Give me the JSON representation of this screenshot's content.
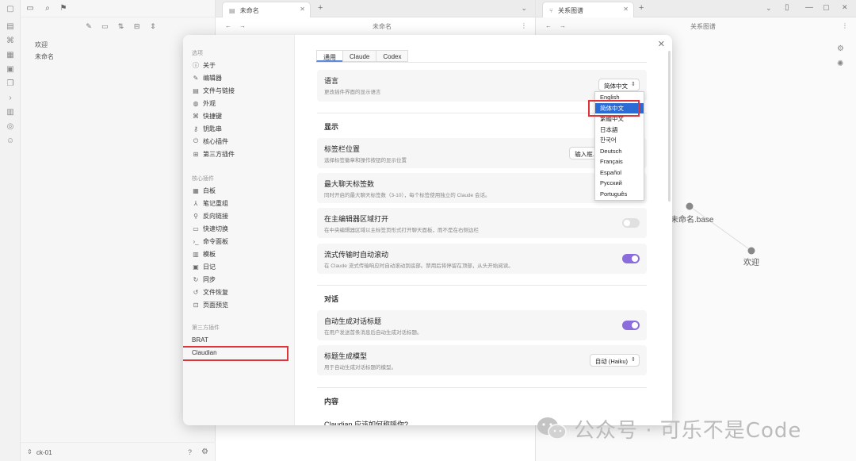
{
  "left_pane": {
    "files": [
      "欢迎",
      "未命名"
    ],
    "vault_name": "ck-01"
  },
  "middle_pane": {
    "tab_label": "未命名",
    "note_title": "未命名"
  },
  "right_pane": {
    "tab_label": "关系图谱",
    "title": "关系图谱",
    "graph_nodes": [
      "未命名.base",
      "欢迎"
    ]
  },
  "modal": {
    "sidebar": {
      "sections": [
        {
          "label": "选项",
          "items": [
            {
              "label": "关于",
              "icon": "info-icon"
            },
            {
              "label": "编辑器",
              "icon": "edit-icon"
            },
            {
              "label": "文件与链接",
              "icon": "file-link-icon"
            },
            {
              "label": "外观",
              "icon": "palette-icon"
            },
            {
              "label": "快捷键",
              "icon": "command-icon"
            },
            {
              "label": "钥匙串",
              "icon": "key-icon"
            },
            {
              "label": "核心插件",
              "icon": "plugin-icon"
            },
            {
              "label": "第三方插件",
              "icon": "puzzle-icon"
            }
          ]
        },
        {
          "label": "核心插件",
          "items": [
            {
              "label": "白板",
              "icon": "canvas-icon"
            },
            {
              "label": "笔记重组",
              "icon": "merge-icon"
            },
            {
              "label": "反向链接",
              "icon": "backlink-icon"
            },
            {
              "label": "快速切换",
              "icon": "switch-icon"
            },
            {
              "label": "命令面板",
              "icon": "terminal-icon"
            },
            {
              "label": "模板",
              "icon": "template-icon"
            },
            {
              "label": "日记",
              "icon": "calendar-icon"
            },
            {
              "label": "同步",
              "icon": "sync-icon"
            },
            {
              "label": "文件恢复",
              "icon": "history-icon"
            },
            {
              "label": "页面预览",
              "icon": "preview-icon"
            }
          ]
        },
        {
          "label": "第三方插件",
          "items": [
            {
              "label": "BRAT"
            },
            {
              "label": "Claudian",
              "active": true
            }
          ]
        }
      ]
    },
    "tabs": [
      "通用",
      "Claude",
      "Codex"
    ],
    "language": {
      "title": "语言",
      "desc": "更改插件界面的显示语言",
      "selected": "简体中文",
      "options": [
        "English",
        "简体中文",
        "繁體中文",
        "日本語",
        "한국어",
        "Deutsch",
        "Français",
        "Español",
        "Русский",
        "Português"
      ]
    },
    "display": {
      "heading": "显示",
      "tab_bar_pos": {
        "title": "标签栏位置",
        "desc": "选择标签徽章和操作按钮的显示位置",
        "value": "输入框..."
      },
      "max_tabs": {
        "title": "最大聊天标签数",
        "desc": "同时开启的最大聊天标签数（3-10），每个标签使用独立的 Claude 会话。"
      },
      "open_in_main": {
        "title": "在主编辑器区域打开",
        "desc": "在中央编辑器区域以主标签页形式打开聊天面板，而不是在右侧边栏",
        "on": false
      },
      "auto_scroll": {
        "title": "流式传输时自动滚动",
        "desc": "在 Claude 流式传输响应时自动滚动到底部。禁用后将停留在顶部，从头开始阅读。",
        "on": true
      }
    },
    "dialog": {
      "heading": "对话",
      "auto_title": {
        "title": "自动生成对话标题",
        "desc": "在用户发送首条消息后自动生成对话标题。",
        "on": true
      },
      "title_model": {
        "title": "标题生成模型",
        "desc": "用于自动生成对话标题的模型。",
        "value": "自动 (Haiku)"
      }
    },
    "content": {
      "heading": "内容",
      "name_q": "Claudian 应该如何称呼你?"
    }
  },
  "watermark": "公众号 · 可乐不是Code"
}
